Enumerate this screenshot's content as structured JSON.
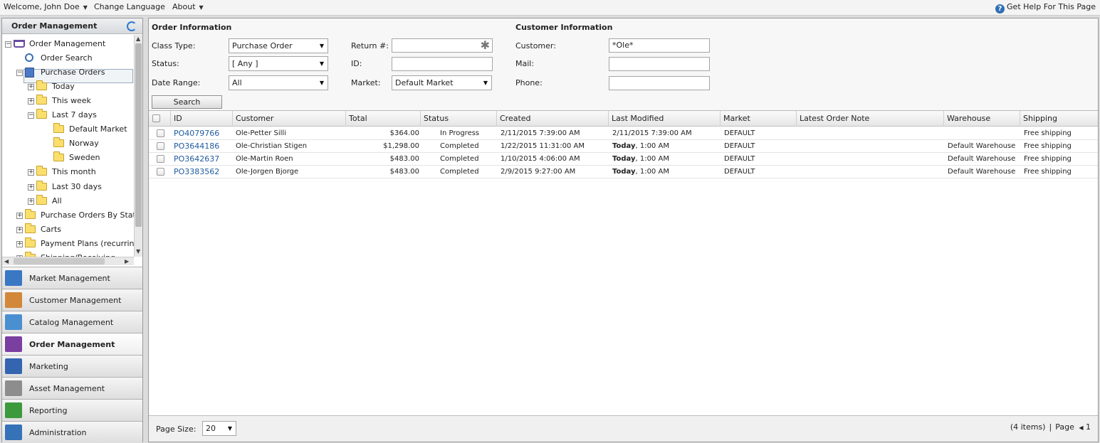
{
  "topbar": {
    "welcome": "Welcome, John Doe",
    "change_language": "Change Language",
    "about": "About",
    "help": "Get Help For This Page"
  },
  "left_panel": {
    "title": "Order Management",
    "tree": [
      {
        "label": "Order Management",
        "level": 0,
        "icon": "cart-icon",
        "expander": "−"
      },
      {
        "label": "Order Search",
        "level": 1,
        "icon": "magnifier-icon",
        "expander": ""
      },
      {
        "label": "Purchase Orders",
        "level": 1,
        "icon": "clipboard-icon",
        "expander": "−"
      },
      {
        "label": "Today",
        "level": 2,
        "icon": "folder-icon",
        "expander": "+"
      },
      {
        "label": "This week",
        "level": 2,
        "icon": "folder-icon",
        "expander": "+"
      },
      {
        "label": "Last 7 days",
        "level": 2,
        "icon": "folder-icon",
        "expander": "−"
      },
      {
        "label": "Default Market",
        "level": 3,
        "icon": "folder-icon",
        "expander": ""
      },
      {
        "label": "Norway",
        "level": 3,
        "icon": "folder-icon",
        "expander": ""
      },
      {
        "label": "Sweden",
        "level": 3,
        "icon": "folder-icon",
        "expander": ""
      },
      {
        "label": "This month",
        "level": 2,
        "icon": "folder-icon",
        "expander": "+"
      },
      {
        "label": "Last 30 days",
        "level": 2,
        "icon": "folder-icon",
        "expander": "+"
      },
      {
        "label": "All",
        "level": 2,
        "icon": "folder-icon",
        "expander": "+"
      },
      {
        "label": "Purchase Orders By Stat",
        "level": 1,
        "icon": "folder-icon",
        "expander": "+"
      },
      {
        "label": "Carts",
        "level": 1,
        "icon": "folder-icon",
        "expander": "+"
      },
      {
        "label": "Payment Plans (recurrin",
        "level": 1,
        "icon": "folder-icon",
        "expander": "+"
      },
      {
        "label": "Shipping/Receiving",
        "level": 1,
        "icon": "folder-icon",
        "expander": "+"
      }
    ],
    "modules": [
      {
        "label": "Market Management",
        "icon": "market-management-icon",
        "color": "#3a78c4",
        "active": false
      },
      {
        "label": "Customer Management",
        "icon": "customers-icon",
        "color": "#d2873a",
        "active": false
      },
      {
        "label": "Catalog Management",
        "icon": "catalog-icon",
        "color": "#4a8fd0",
        "active": false
      },
      {
        "label": "Order Management",
        "icon": "cart-icon",
        "color": "#7a3fa0",
        "active": true
      },
      {
        "label": "Marketing",
        "icon": "marketing-icon",
        "color": "#3465b0",
        "active": false
      },
      {
        "label": "Asset Management",
        "icon": "asset-icon",
        "color": "#8d8d8d",
        "active": false
      },
      {
        "label": "Reporting",
        "icon": "reporting-icon",
        "color": "#3c9a3c",
        "active": false
      },
      {
        "label": "Administration",
        "icon": "administration-icon",
        "color": "#3572b8",
        "active": false
      }
    ]
  },
  "order_info": {
    "title": "Order Information",
    "class_type_label": "Class Type:",
    "class_type_value": "Purchase Order",
    "status_label": "Status:",
    "status_value": "[ Any ]",
    "date_range_label": "Date Range:",
    "date_range_value": "All",
    "return_label": "Return #:",
    "return_value": "",
    "id_label": "ID:",
    "id_value": "",
    "market_label": "Market:",
    "market_value": "Default Market",
    "search_button": "Search"
  },
  "customer_info": {
    "title": "Customer Information",
    "customer_label": "Customer:",
    "customer_value": "*Ole*",
    "mail_label": "Mail:",
    "mail_value": "",
    "phone_label": "Phone:",
    "phone_value": ""
  },
  "grid": {
    "columns": [
      "ID",
      "Customer",
      "Total",
      "Status",
      "Created",
      "Last Modified",
      "Market",
      "Latest Order Note",
      "Warehouse",
      "Shipping"
    ],
    "rows": [
      {
        "id": "PO4079766",
        "customer": "Ole-Petter Silli",
        "total": "$364.00",
        "status": "In Progress",
        "created": "2/11/2015 7:39:00 AM",
        "modified_bold": "",
        "modified": "2/11/2015 7:39:00 AM",
        "market": "DEFAULT",
        "note": "",
        "warehouse": "",
        "shipping": "Free shipping"
      },
      {
        "id": "PO3644186",
        "customer": "Ole-Christian Stigen",
        "total": "$1,298.00",
        "status": "Completed",
        "created": "1/22/2015 11:31:00 AM",
        "modified_bold": "Today",
        "modified": ", 1:00 AM",
        "market": "DEFAULT",
        "note": "",
        "warehouse": "Default Warehouse",
        "shipping": "Free shipping"
      },
      {
        "id": "PO3642637",
        "customer": "Ole-Martin Roen",
        "total": "$483.00",
        "status": "Completed",
        "created": "1/10/2015 4:06:00 AM",
        "modified_bold": "Today",
        "modified": ", 1:00 AM",
        "market": "DEFAULT",
        "note": "",
        "warehouse": "Default Warehouse",
        "shipping": "Free shipping"
      },
      {
        "id": "PO3383562",
        "customer": "Ole-Jorgen Bjorge",
        "total": "$483.00",
        "status": "Completed",
        "created": "2/9/2015 9:27:00 AM",
        "modified_bold": "Today",
        "modified": ", 1:00 AM",
        "market": "DEFAULT",
        "note": "",
        "warehouse": "Default Warehouse",
        "shipping": "Free shipping"
      }
    ]
  },
  "footer": {
    "page_size_label": "Page Size:",
    "page_size_value": "20",
    "items": "(4 items)",
    "sep": "|",
    "page_label": "Page",
    "page_number": "1"
  }
}
